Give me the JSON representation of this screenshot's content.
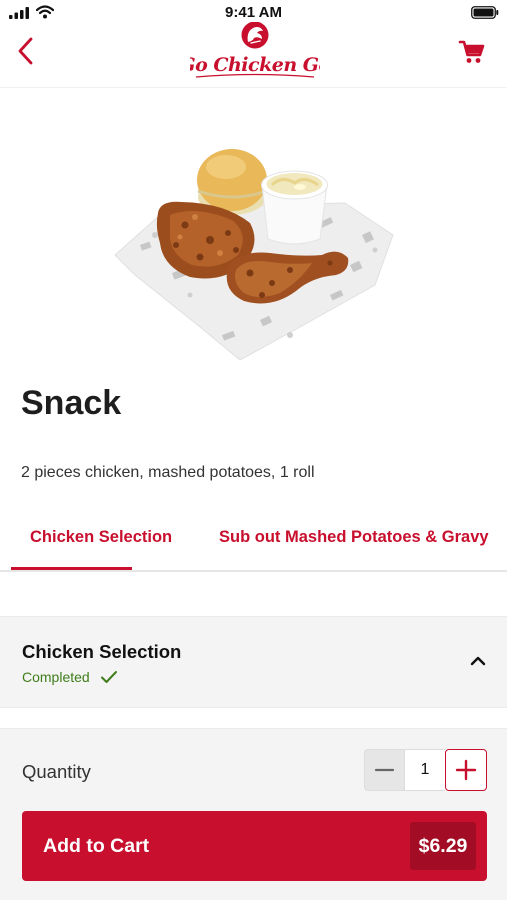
{
  "status_bar": {
    "time": "9:41 AM"
  },
  "header": {
    "logo_text": "Go Chicken Go"
  },
  "product": {
    "title": "Snack",
    "description": "2 pieces chicken, mashed potatoes, 1 roll"
  },
  "tabs": [
    {
      "label": "Chicken Selection",
      "active": true
    },
    {
      "label": "Sub out Mashed Potatoes & Gravy",
      "active": false
    }
  ],
  "section": {
    "title": "Chicken Selection",
    "status": "Completed"
  },
  "footer": {
    "quantity_label": "Quantity",
    "quantity_value": "1",
    "add_to_cart_label": "Add to Cart",
    "price": "$6.29"
  },
  "colors": {
    "brand_red": "#c8102e",
    "dark_red": "#a30c25",
    "success_green": "#3f7d1b"
  },
  "icons": [
    "signal-icon",
    "wifi-icon",
    "battery-icon",
    "back-chevron-icon",
    "cart-icon",
    "check-icon",
    "chevron-up-icon",
    "minus-icon",
    "plus-icon"
  ]
}
